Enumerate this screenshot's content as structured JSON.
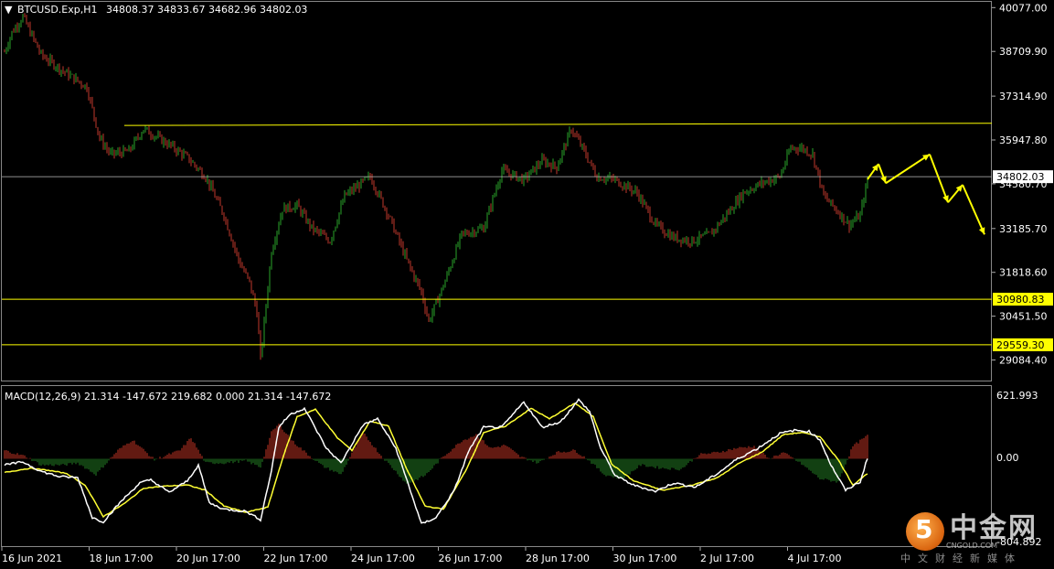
{
  "header": {
    "arrow": "▼",
    "title": "BTCUSD.Exp,H1",
    "ohlc": "34808.37 34833.67 34682.96 34802.03"
  },
  "macd": {
    "label": "MACD(12,26,9) 21.314 -147.672 219.682 0.000 21.314 -147.672",
    "top_label": "621.993",
    "zero_label": "0.00",
    "bottom_label": "-804.892"
  },
  "watermark": {
    "logo_char": "5",
    "title": "中金网",
    "sub": "CNGOLD.COM",
    "cn": "中文财经新媒体"
  },
  "colors": {
    "background": "#000000",
    "bull": "#2aa52a",
    "bear": "#c0392b",
    "level": "#ffff00",
    "macd_main": "#ffffff",
    "macd_signal": "#ffff33",
    "hist_pos": "#a32b1f",
    "hist_neg": "#1f6b1f"
  },
  "chart_data": [
    {
      "type": "candlestick",
      "symbol": "BTCUSD.Exp",
      "timeframe": "H1",
      "y_ticks": [
        "40077.00",
        "38709.90",
        "37314.90",
        "35947.80",
        "34580.70",
        "33185.70",
        "31818.60",
        "30451.50",
        "29084.40"
      ],
      "x_ticks": [
        "16 Jun 2021",
        "18 Jun 17:00",
        "20 Jun 17:00",
        "22 Jun 17:00",
        "24 Jun 17:00",
        "26 Jun 17:00",
        "28 Jun 17:00",
        "30 Jun 17:00",
        "2 Jul 17:00",
        "4 Jul 17:00"
      ],
      "ylim": [
        28500,
        40200
      ],
      "current_price_label": "34802.03",
      "levels": [
        {
          "label": "",
          "value": 36450,
          "slanted": true,
          "from_value": 36400,
          "to_value": 36470
        },
        {
          "label": "30980.83",
          "value": 30980.83
        },
        {
          "label": "29559.30",
          "value": 29559.3
        }
      ],
      "anchors": [
        [
          0,
          38700
        ],
        [
          4,
          39300
        ],
        [
          10,
          39800
        ],
        [
          20,
          38600
        ],
        [
          32,
          38100
        ],
        [
          45,
          37600
        ],
        [
          52,
          36000
        ],
        [
          58,
          35500
        ],
        [
          68,
          35600
        ],
        [
          76,
          36300
        ],
        [
          90,
          35800
        ],
        [
          100,
          35400
        ],
        [
          110,
          34800
        ],
        [
          120,
          33600
        ],
        [
          128,
          32200
        ],
        [
          134,
          31500
        ],
        [
          138,
          30600
        ],
        [
          140,
          29100
        ],
        [
          146,
          32500
        ],
        [
          152,
          33800
        ],
        [
          160,
          33900
        ],
        [
          168,
          33200
        ],
        [
          178,
          32800
        ],
        [
          186,
          34200
        ],
        [
          200,
          34800
        ],
        [
          210,
          33600
        ],
        [
          220,
          32200
        ],
        [
          228,
          31200
        ],
        [
          232,
          30300
        ],
        [
          240,
          31400
        ],
        [
          250,
          33000
        ],
        [
          262,
          33200
        ],
        [
          272,
          35000
        ],
        [
          284,
          34700
        ],
        [
          294,
          35300
        ],
        [
          302,
          35100
        ],
        [
          310,
          36300
        ],
        [
          316,
          35700
        ],
        [
          324,
          34800
        ],
        [
          334,
          34700
        ],
        [
          346,
          34300
        ],
        [
          356,
          33300
        ],
        [
          366,
          32900
        ],
        [
          376,
          32800
        ],
        [
          386,
          33000
        ],
        [
          396,
          33700
        ],
        [
          404,
          34300
        ],
        [
          414,
          34600
        ],
        [
          424,
          34800
        ],
        [
          430,
          35700
        ],
        [
          436,
          35700
        ],
        [
          442,
          35500
        ],
        [
          448,
          34200
        ],
        [
          456,
          33700
        ],
        [
          462,
          33300
        ],
        [
          468,
          33600
        ],
        [
          472,
          34700
        ]
      ],
      "forecast_arrows": [
        [
          472,
          34720
        ],
        [
          478,
          35200
        ],
        [
          482,
          34600
        ],
        [
          506,
          35500
        ],
        [
          516,
          34000
        ],
        [
          524,
          34550
        ],
        [
          536,
          33000
        ]
      ]
    },
    {
      "type": "macd",
      "params": "12,26,9",
      "ylim": [
        -804.892,
        621.993
      ],
      "anchors_main": [
        [
          0,
          -60
        ],
        [
          10,
          -30
        ],
        [
          20,
          -120
        ],
        [
          30,
          -170
        ],
        [
          40,
          -180
        ],
        [
          48,
          -560
        ],
        [
          54,
          -600
        ],
        [
          64,
          -400
        ],
        [
          74,
          -230
        ],
        [
          80,
          -200
        ],
        [
          90,
          -320
        ],
        [
          100,
          -210
        ],
        [
          106,
          -60
        ],
        [
          112,
          -420
        ],
        [
          120,
          -480
        ],
        [
          132,
          -500
        ],
        [
          140,
          -580
        ],
        [
          146,
          -110
        ],
        [
          150,
          300
        ],
        [
          156,
          420
        ],
        [
          164,
          480
        ],
        [
          176,
          100
        ],
        [
          184,
          -40
        ],
        [
          196,
          320
        ],
        [
          204,
          380
        ],
        [
          214,
          100
        ],
        [
          220,
          -200
        ],
        [
          228,
          -620
        ],
        [
          236,
          -560
        ],
        [
          246,
          -300
        ],
        [
          254,
          80
        ],
        [
          262,
          300
        ],
        [
          272,
          300
        ],
        [
          284,
          540
        ],
        [
          294,
          300
        ],
        [
          304,
          350
        ],
        [
          314,
          560
        ],
        [
          320,
          450
        ],
        [
          326,
          100
        ],
        [
          334,
          -160
        ],
        [
          344,
          -250
        ],
        [
          356,
          -310
        ],
        [
          366,
          -230
        ],
        [
          378,
          -270
        ],
        [
          390,
          -140
        ],
        [
          400,
          -10
        ],
        [
          412,
          100
        ],
        [
          424,
          240
        ],
        [
          432,
          270
        ],
        [
          440,
          260
        ],
        [
          446,
          180
        ],
        [
          452,
          -60
        ],
        [
          460,
          -300
        ],
        [
          468,
          -220
        ],
        [
          472,
          10
        ]
      ],
      "anchors_signal": [
        [
          0,
          -130
        ],
        [
          14,
          -90
        ],
        [
          24,
          -110
        ],
        [
          34,
          -140
        ],
        [
          44,
          -250
        ],
        [
          54,
          -550
        ],
        [
          66,
          -420
        ],
        [
          76,
          -280
        ],
        [
          88,
          -260
        ],
        [
          100,
          -250
        ],
        [
          110,
          -300
        ],
        [
          120,
          -450
        ],
        [
          132,
          -510
        ],
        [
          144,
          -460
        ],
        [
          152,
          0
        ],
        [
          160,
          400
        ],
        [
          170,
          470
        ],
        [
          182,
          200
        ],
        [
          190,
          80
        ],
        [
          200,
          360
        ],
        [
          210,
          310
        ],
        [
          220,
          -100
        ],
        [
          230,
          -450
        ],
        [
          240,
          -480
        ],
        [
          252,
          -120
        ],
        [
          262,
          250
        ],
        [
          274,
          310
        ],
        [
          288,
          480
        ],
        [
          298,
          380
        ],
        [
          312,
          530
        ],
        [
          322,
          400
        ],
        [
          332,
          -50
        ],
        [
          344,
          -210
        ],
        [
          360,
          -300
        ],
        [
          376,
          -250
        ],
        [
          390,
          -180
        ],
        [
          402,
          -40
        ],
        [
          414,
          60
        ],
        [
          426,
          230
        ],
        [
          436,
          250
        ],
        [
          446,
          210
        ],
        [
          456,
          -10
        ],
        [
          464,
          -250
        ],
        [
          472,
          -140
        ]
      ],
      "hist_anchors": [
        [
          0,
          80
        ],
        [
          12,
          20
        ],
        [
          20,
          -60
        ],
        [
          32,
          -60
        ],
        [
          40,
          -40
        ],
        [
          50,
          -150
        ],
        [
          62,
          80
        ],
        [
          70,
          180
        ],
        [
          82,
          -10
        ],
        [
          96,
          80
        ],
        [
          102,
          200
        ],
        [
          110,
          -40
        ],
        [
          120,
          -40
        ],
        [
          132,
          -20
        ],
        [
          140,
          -80
        ],
        [
          146,
          250
        ],
        [
          150,
          330
        ],
        [
          158,
          160
        ],
        [
          166,
          40
        ],
        [
          174,
          -70
        ],
        [
          184,
          -150
        ],
        [
          196,
          250
        ],
        [
          206,
          30
        ],
        [
          214,
          -120
        ],
        [
          220,
          -240
        ],
        [
          230,
          -160
        ],
        [
          240,
          20
        ],
        [
          250,
          170
        ],
        [
          258,
          230
        ],
        [
          266,
          100
        ],
        [
          274,
          130
        ],
        [
          282,
          20
        ],
        [
          292,
          -40
        ],
        [
          302,
          60
        ],
        [
          312,
          80
        ],
        [
          320,
          -20
        ],
        [
          328,
          -150
        ],
        [
          338,
          -190
        ],
        [
          348,
          -60
        ],
        [
          360,
          -90
        ],
        [
          370,
          -100
        ],
        [
          380,
          40
        ],
        [
          390,
          60
        ],
        [
          400,
          100
        ],
        [
          410,
          120
        ],
        [
          418,
          0
        ],
        [
          426,
          60
        ],
        [
          436,
          -50
        ],
        [
          446,
          -190
        ],
        [
          456,
          -220
        ],
        [
          464,
          120
        ],
        [
          472,
          220
        ]
      ]
    }
  ]
}
